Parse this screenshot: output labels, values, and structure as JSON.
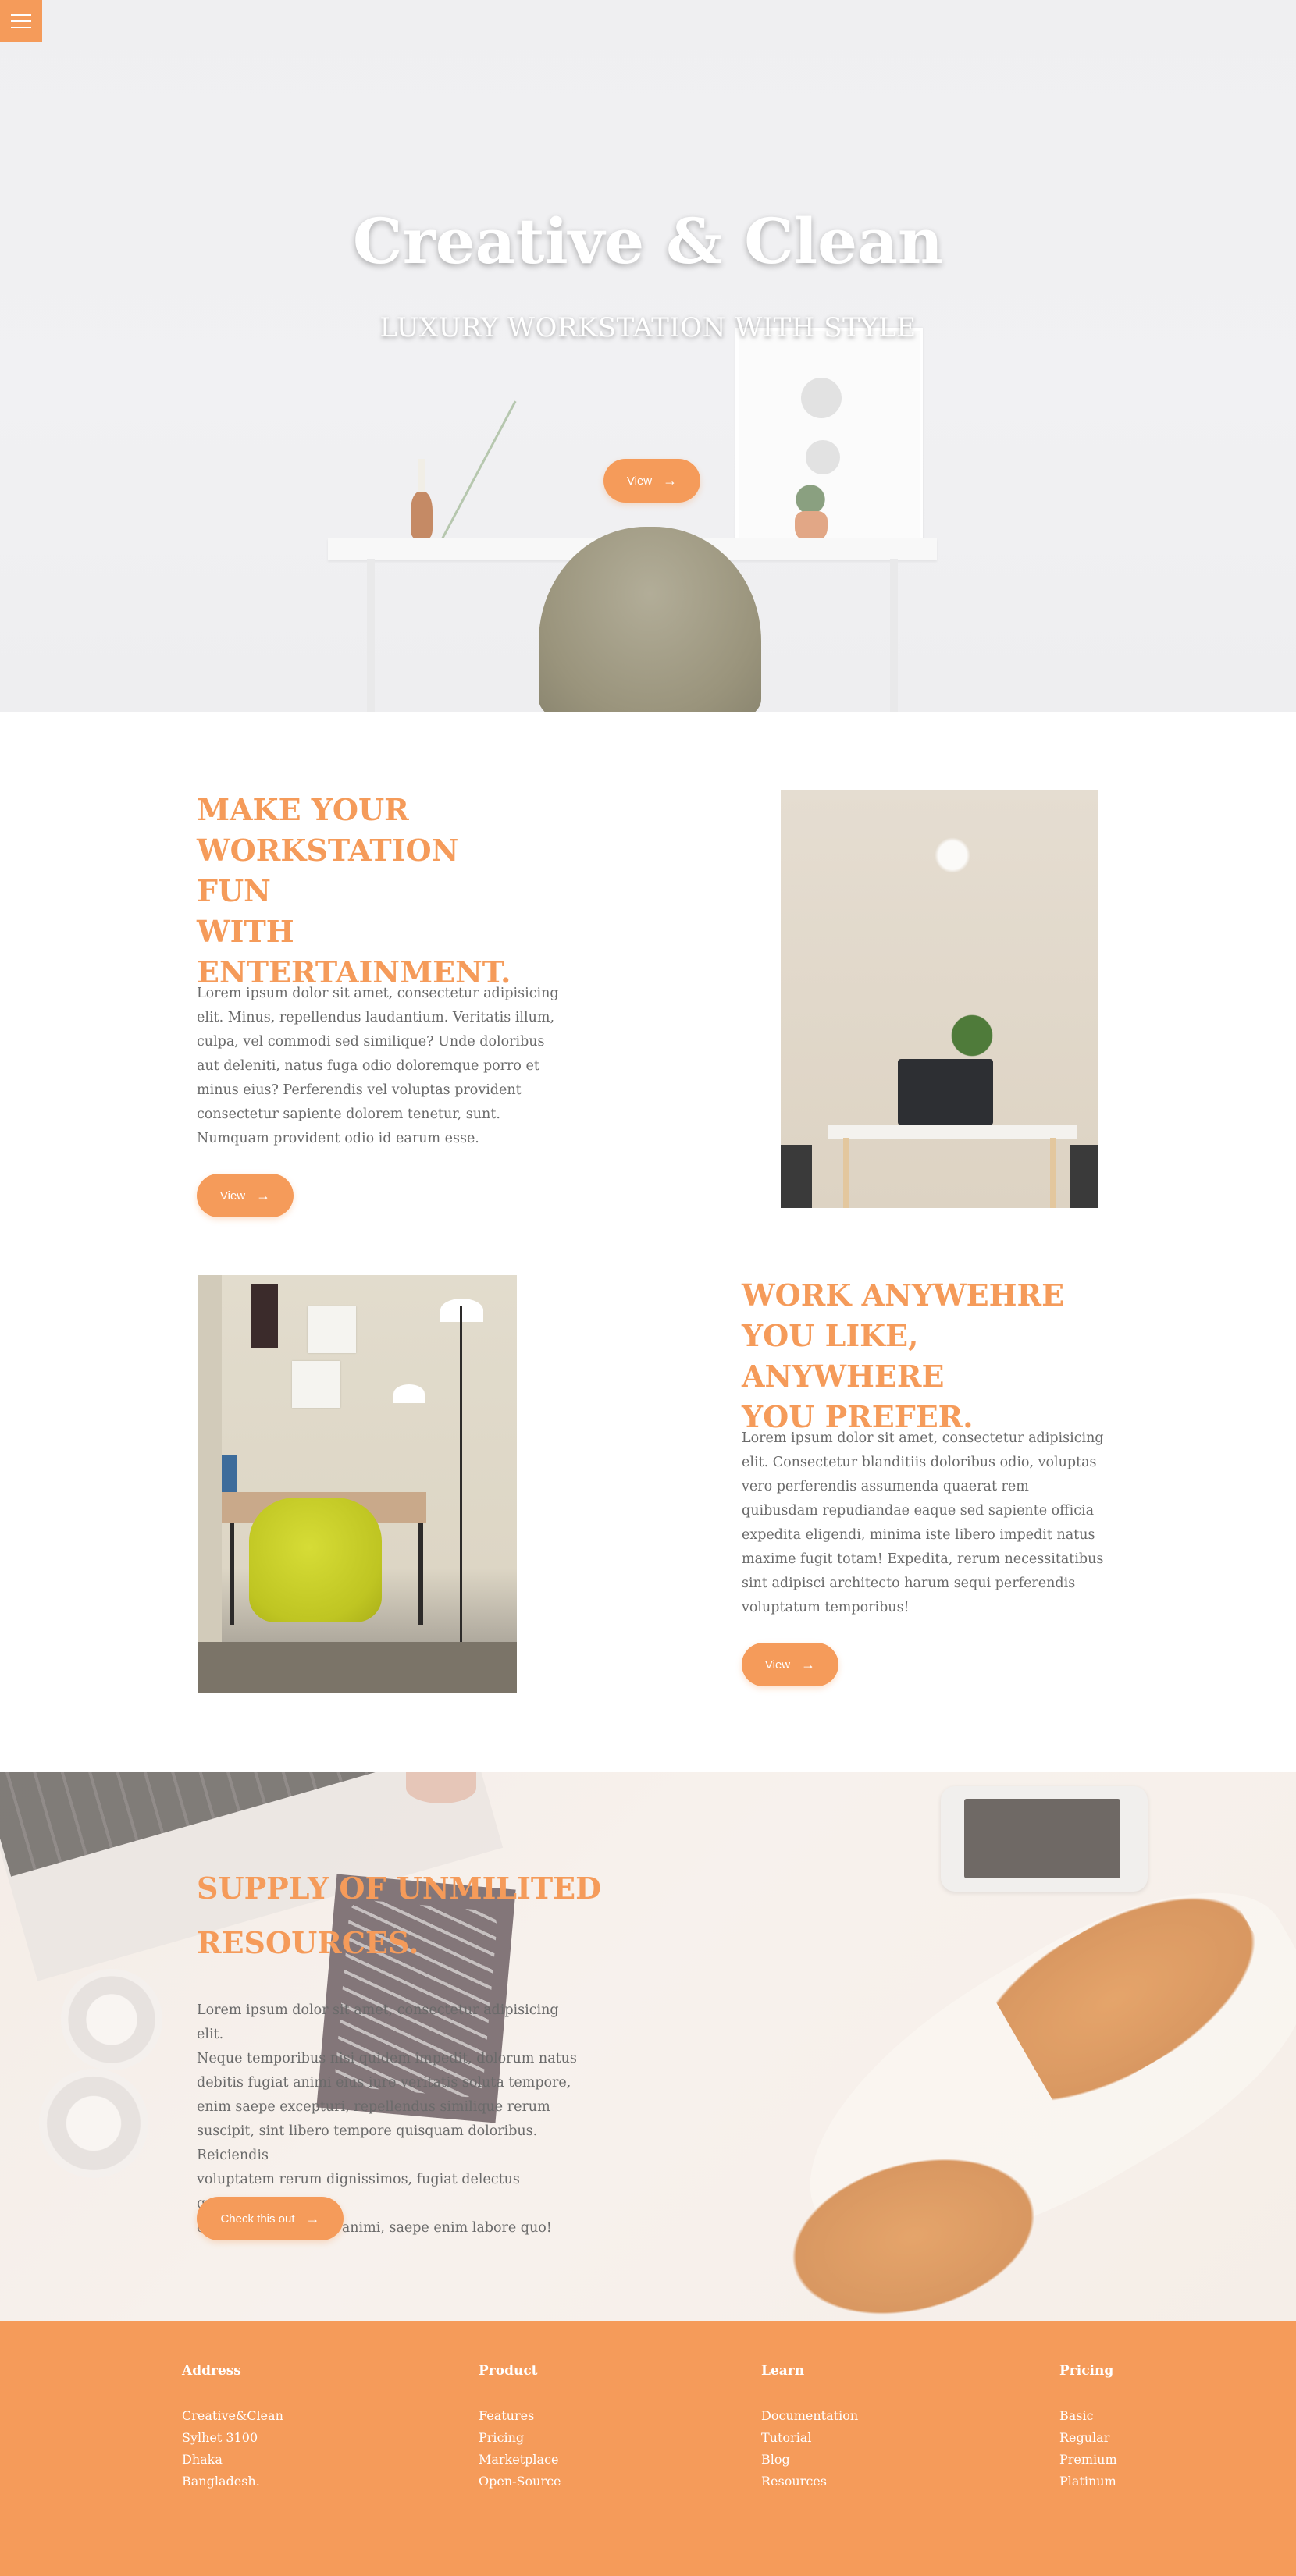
{
  "nav": {
    "menu_icon": "hamburger-icon"
  },
  "hero": {
    "title": "Creative & Clean",
    "subtitle": "LUXURY WORKSTATION WITH STYLE",
    "button_label": "View",
    "arrow": "→"
  },
  "feature1": {
    "title_lines": [
      "MAKE YOUR",
      "WORKSTATION FUN",
      "WITH",
      "ENTERTAINMENT."
    ],
    "text_lines": [
      "Lorem ipsum dolor sit amet, consectetur adipisicing",
      "elit. Minus, repellendus laudantium. Veritatis illum,",
      "culpa, vel commodi sed similique? Unde doloribus",
      "aut deleniti, natus fuga odio doloremque porro et",
      "minus eius? Perferendis vel voluptas provident",
      "consectetur sapiente dolorem tenetur, sunt.",
      "Numquam provident odio id earum esse."
    ],
    "button_label": "View"
  },
  "feature2": {
    "title_lines": [
      "WORK ANYWEHRE",
      "YOU LIKE, ANYWHERE",
      "YOU PREFER."
    ],
    "text_lines": [
      "Lorem ipsum dolor sit amet, consectetur adipisicing",
      "elit. Consectetur blanditiis doloribus odio, voluptas",
      "vero perferendis assumenda quaerat rem",
      "quibusdam repudiandae eaque sed sapiente officia",
      "expedita eligendi, minima iste libero impedit natus",
      "maxime fugit totam! Expedita, rerum necessitatibus",
      "sint adipisci architecto harum sequi perferendis",
      "voluptatum temporibus!"
    ],
    "button_label": "View"
  },
  "supply": {
    "title_lines": [
      "SUPPLY OF UNMILITED",
      "RESOURCES."
    ],
    "text_lines": [
      "Lorem ipsum dolor sit amet, consectetur adipisicing elit.",
      "Neque temporibus nisi quidem impedit, dolorum natus",
      "debitis fugiat animi eius iure veritatis soluta tempore,",
      "enim saepe excepturi, repellendus similique rerum",
      "suscipit, sint libero tempore quisquam doloribus. Reiciendis",
      "voluptatem rerum dignissimos, fugiat delectus quisquam",
      "cupiditate obcaecati animi, saepe enim labore quo!"
    ],
    "button_label": "Check this out"
  },
  "footer": {
    "columns": [
      {
        "heading": "Address",
        "items": [
          "Creative&Clean",
          "Sylhet 3100",
          "Dhaka",
          "Bangladesh."
        ]
      },
      {
        "heading": "Product",
        "items": [
          "Features",
          "Pricing",
          "Marketplace",
          "Open-Source"
        ]
      },
      {
        "heading": "Learn",
        "items": [
          "Documentation",
          "Tutorial",
          "Blog",
          "Resources"
        ]
      },
      {
        "heading": "Pricing",
        "items": [
          "Basic",
          "Regular",
          "Premium",
          "Platinum"
        ]
      }
    ]
  },
  "colors": {
    "accent": "#f59b5a",
    "text": "#6a6a6a"
  }
}
